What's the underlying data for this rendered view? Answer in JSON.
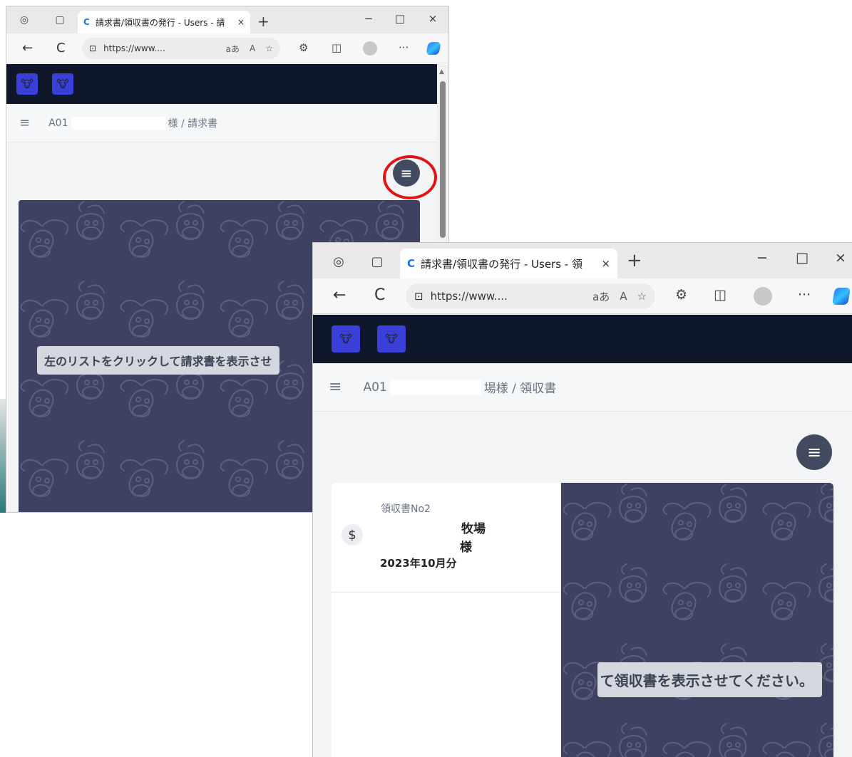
{
  "colors": {
    "app_bar": "#0f172a",
    "menu_fab": "#424a5f",
    "cow_panel": "#3e4160",
    "highlight_ring": "#e11414",
    "logo_bg": "#3a3fd8"
  },
  "icons": {
    "back": "←",
    "reload": "C",
    "lock": "⊡",
    "read_aloud": "A",
    "favorite": "☆",
    "extensions": "⚙",
    "split": "◫",
    "more": "···",
    "hamburger": "≡",
    "dollar": "$",
    "tab_actions": "◎",
    "tab_square": "▢",
    "close": "×",
    "plus": "+",
    "minimize": "−",
    "maximize": "□"
  },
  "win1": {
    "tab_title": "請求書/領収書の発行 - Users - 請",
    "url": "https://www....",
    "omni_ime": "aあ",
    "breadcrumb_prefix": "A01",
    "breadcrumb_suffix": "様 / 請求書",
    "hint": "左のリストをクリックして請求書を表示させ"
  },
  "win2": {
    "tab_title": "請求書/領収書の発行 - Users - 領",
    "url": "https://www....",
    "omni_ime": "aあ",
    "breadcrumb_prefix": "A01",
    "breadcrumb_suffix": "場様 / 領収書",
    "hint": "て領収書を表示させてください。",
    "list": [
      {
        "number": "領収書No2",
        "farm": "牧場",
        "sama": "様",
        "month": "2023年10月分"
      }
    ]
  }
}
